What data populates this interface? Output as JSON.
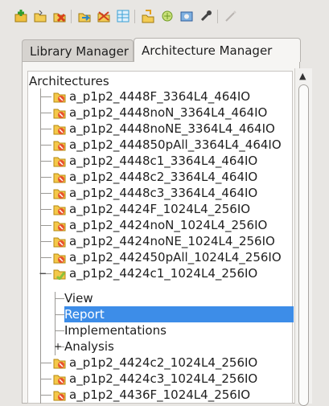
{
  "toolbar": {
    "buttons": [
      {
        "name": "new-icon",
        "color": "#3da63d"
      },
      {
        "name": "open-icon",
        "color": "#c89a2a"
      },
      {
        "name": "delete-icon",
        "color": "#d8401c"
      },
      {
        "name": "import-icon",
        "color": "#3a9ed8"
      },
      {
        "name": "export-icon",
        "color": "#d24020"
      },
      {
        "name": "table-icon",
        "color": "#3aa0d6"
      },
      {
        "name": "run-icon",
        "color": "#e2a020"
      },
      {
        "name": "plugin-icon",
        "color": "#8bb34a"
      },
      {
        "name": "settings-icon",
        "color": "#3a7ac8"
      },
      {
        "name": "tool-icon",
        "color": "#444444"
      },
      {
        "name": "wand-icon",
        "color": "#b9b5b1"
      }
    ]
  },
  "tabs": [
    {
      "label": "Library Manager",
      "active": false
    },
    {
      "label": "Architecture Manager",
      "active": true
    }
  ],
  "tree": {
    "header": "Architectures",
    "items": [
      {
        "label": "a_p1p2_4448F_3364L4_464IO"
      },
      {
        "label": "a_p1p2_4448noN_3364L4_464IO"
      },
      {
        "label": "a_p1p2_4448noNE_3364L4_464IO"
      },
      {
        "label": "a_p1p2_444850pAll_3364L4_464IO"
      },
      {
        "label": "a_p1p2_4448c1_3364L4_464IO"
      },
      {
        "label": "a_p1p2_4448c2_3364L4_464IO"
      },
      {
        "label": "a_p1p2_4448c3_3364L4_464IO"
      },
      {
        "label": "a_p1p2_4424F_1024L4_256IO"
      },
      {
        "label": "a_p1p2_4424noN_1024L4_256IO"
      },
      {
        "label": "a_p1p2_4424noNE_1024L4_256IO"
      },
      {
        "label": "a_p1p2_442450pAll_1024L4_256IO"
      },
      {
        "label": "a_p1p2_4424c1_1024L4_256IO"
      },
      {
        "label": "a_p1p2_4424c2_1024L4_256IO"
      },
      {
        "label": "a_p1p2_4424c3_1024L4_256IO"
      },
      {
        "label": "a_p1p2_4436F_1024L4_256IO"
      }
    ],
    "children": [
      {
        "label": "View"
      },
      {
        "label": "Report",
        "selected": true
      },
      {
        "label": "Implementations"
      },
      {
        "label": "Analysis"
      }
    ],
    "selection_color": "#3d8de8",
    "arch_icon_color": "#e8532e",
    "open_icon_color": "#8ac23c"
  }
}
